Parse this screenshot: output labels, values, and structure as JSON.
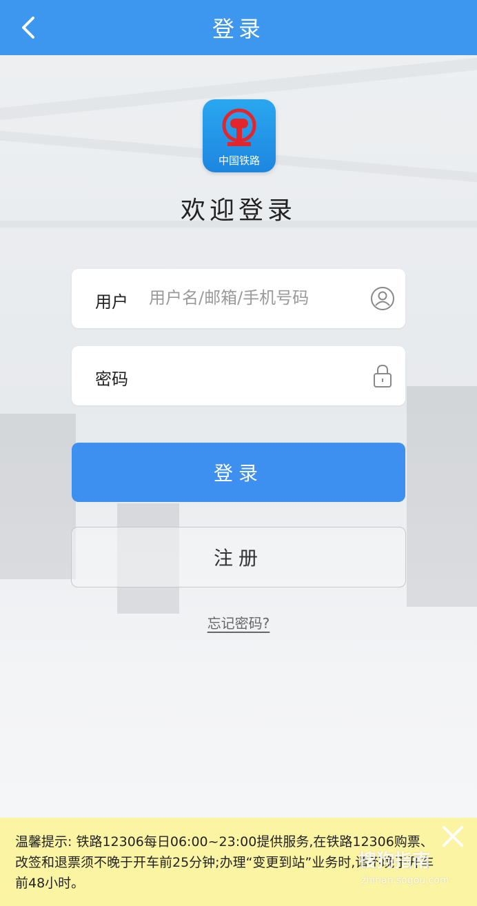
{
  "header": {
    "title": "登录"
  },
  "logo": {
    "caption": "中国铁路"
  },
  "welcome": "欢迎登录",
  "form": {
    "user_label": "用户",
    "user_placeholder": "用户名/邮箱/手机号码",
    "password_label": "密码"
  },
  "buttons": {
    "login": "登录",
    "register": "注册",
    "forgot": "忘记密码?"
  },
  "notice": {
    "text": "温馨提示: 铁路12306每日06:00~23:00提供服务,在铁路12306购票、改签和退票须不晚于开车前25分钟;办理“变更到站”业务时,请不晚于开车前48小时。"
  },
  "watermark": {
    "brand": "搜狗指南",
    "url": "zhinan.sogou.com"
  },
  "colors": {
    "header": "#3d97ee",
    "login_button": "#3d8ff0",
    "notice_bg": "#fbf4a3",
    "logo_red": "#e3262c"
  },
  "icons": {
    "back": "chevron-left-icon",
    "user": "user-circle-icon",
    "password": "lock-icon",
    "close": "close-icon"
  }
}
